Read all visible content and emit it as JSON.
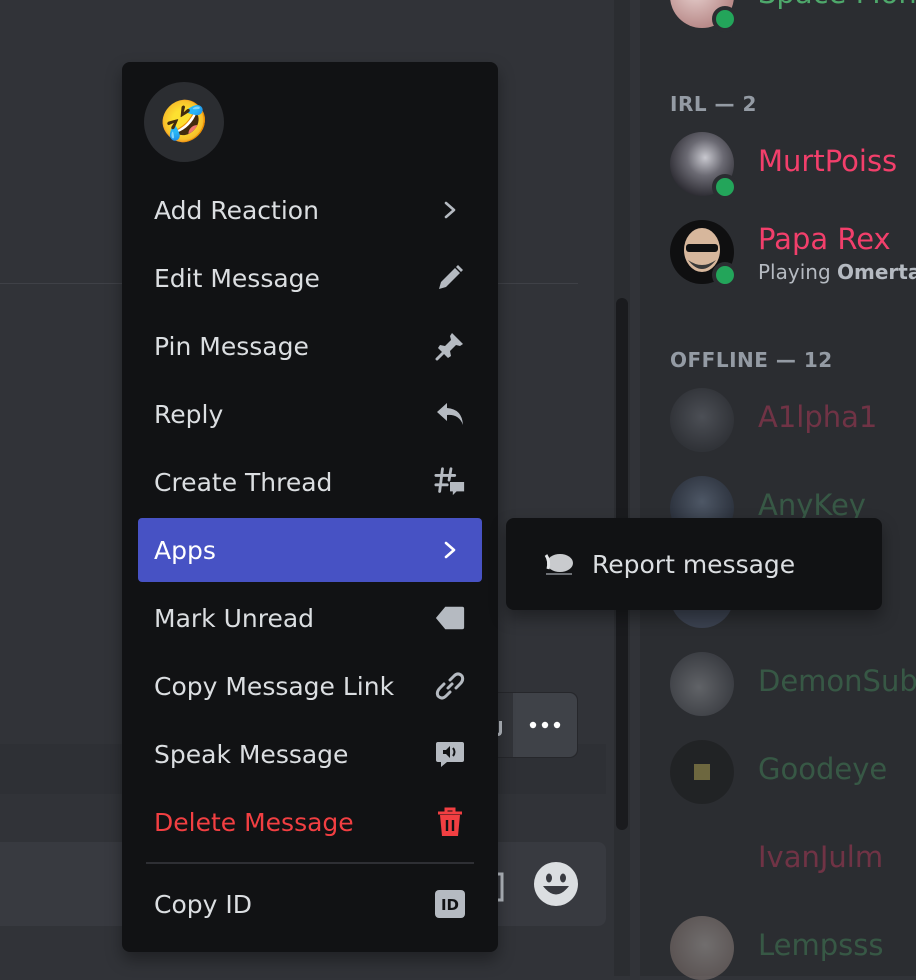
{
  "members": {
    "top_partial": {
      "name": "Space Mons"
    },
    "sections": [
      {
        "label": "IRL — 2"
      },
      {
        "label": "OFFLINE — 12"
      }
    ],
    "irl": [
      {
        "name": "MurtPoiss",
        "color": "#f23f6b"
      },
      {
        "name": "Papa Rex",
        "color": "#f23f6b",
        "activity_prefix": "Playing ",
        "activity_game": "Omerta"
      }
    ],
    "offline": [
      {
        "name": "A1lpha1",
        "color": "#f23f6b"
      },
      {
        "name": "AnyKey",
        "color": "#4ea86b"
      },
      {
        "name": "DemonSubi",
        "color": "#4ea86b"
      },
      {
        "name": "Goodeye",
        "color": "#4ea86b"
      },
      {
        "name": "IvanJulm",
        "color": "#f23f6b"
      },
      {
        "name": "Lempsss",
        "color": "#4ea86b"
      }
    ]
  },
  "context_menu": {
    "quick_reaction_emoji": "🤣",
    "items": [
      {
        "label": "Add Reaction",
        "icon": "chevron-right-icon"
      },
      {
        "label": "Edit Message",
        "icon": "pencil-icon"
      },
      {
        "label": "Pin Message",
        "icon": "pin-icon"
      },
      {
        "label": "Reply",
        "icon": "reply-icon"
      },
      {
        "label": "Create Thread",
        "icon": "thread-icon"
      },
      {
        "label": "Apps",
        "icon": "chevron-right-icon",
        "active": true
      },
      {
        "label": "Mark Unread",
        "icon": "mark-unread-icon"
      },
      {
        "label": "Copy Message Link",
        "icon": "link-icon"
      },
      {
        "label": "Speak Message",
        "icon": "speak-icon"
      },
      {
        "label": "Delete Message",
        "icon": "trash-icon",
        "danger": true
      },
      {
        "label": "Copy ID",
        "icon": "id-icon"
      }
    ]
  },
  "apps_submenu": {
    "items": [
      {
        "label": "Report message",
        "icon": "app-avatar-icon"
      }
    ]
  },
  "colors": {
    "accent": "#4752c4",
    "danger": "#f23f42",
    "online": "#23a55a",
    "menu_bg": "#111214"
  }
}
